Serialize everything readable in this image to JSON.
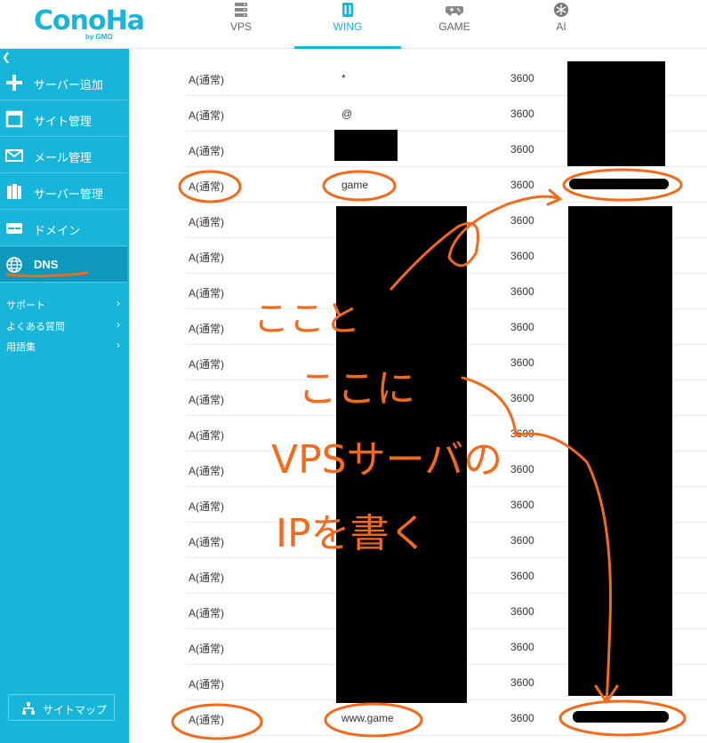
{
  "brand": {
    "logo": "ConoHa",
    "sub": "by GMO"
  },
  "nav": {
    "tabs": [
      {
        "label": "VPS",
        "icon": "server-icon"
      },
      {
        "label": "WING",
        "icon": "wing-icon"
      },
      {
        "label": "GAME",
        "icon": "gamepad-icon"
      },
      {
        "label": "AI",
        "icon": "ai-icon"
      }
    ],
    "active": "WING"
  },
  "sidebar": {
    "items": [
      {
        "label": "サーバー追加",
        "icon": "plus-icon"
      },
      {
        "label": "サイト管理",
        "icon": "window-icon"
      },
      {
        "label": "メール管理",
        "icon": "mail-icon"
      },
      {
        "label": "サーバー管理",
        "icon": "server-stack-icon"
      },
      {
        "label": "ドメイン",
        "icon": "domain-icon"
      },
      {
        "label": "DNS",
        "icon": "globe-icon"
      }
    ],
    "active": "DNS",
    "links": [
      {
        "label": "サポート"
      },
      {
        "label": "よくある質問"
      },
      {
        "label": "用語集"
      }
    ],
    "sitemap_label": "サイトマップ"
  },
  "records": [
    {
      "type": "A(通常)",
      "name": "*",
      "ttl": "3600"
    },
    {
      "type": "A(通常)",
      "name": "@",
      "ttl": "3600"
    },
    {
      "type": "A(通常)",
      "name": "",
      "ttl": "3600"
    },
    {
      "type": "A(通常)",
      "name": "game",
      "ttl": "3600"
    },
    {
      "type": "A(通常)",
      "name": "",
      "ttl": "3600"
    },
    {
      "type": "A(通常)",
      "name": "",
      "ttl": "3600"
    },
    {
      "type": "A(通常)",
      "name": "",
      "ttl": "3600"
    },
    {
      "type": "A(通常)",
      "name": "",
      "ttl": "3600"
    },
    {
      "type": "A(通常)",
      "name": "",
      "ttl": "3600"
    },
    {
      "type": "A(通常)",
      "name": "",
      "ttl": "3600"
    },
    {
      "type": "A(通常)",
      "name": "",
      "ttl": "3600"
    },
    {
      "type": "A(通常)",
      "name": "",
      "ttl": "3600"
    },
    {
      "type": "A(通常)",
      "name": "",
      "ttl": "3600"
    },
    {
      "type": "A(通常)",
      "name": "",
      "ttl": "3600"
    },
    {
      "type": "A(通常)",
      "name": "",
      "ttl": "3600"
    },
    {
      "type": "A(通常)",
      "name": "",
      "ttl": "3600"
    },
    {
      "type": "A(通常)",
      "name": "",
      "ttl": "3600"
    },
    {
      "type": "A(通常)",
      "name": "",
      "ttl": "3600"
    },
    {
      "type": "A(通常)",
      "name": "www.game",
      "ttl": "3600"
    }
  ],
  "annotation": {
    "line1": "ここと",
    "line2": "ここに",
    "line3": "VPSサーバの",
    "line4": "IPを書く",
    "color": "#f26a1b"
  },
  "colors": {
    "accent": "#16b5d9",
    "sidebar_active": "#0e98bc",
    "annotation": "#f26a1b"
  }
}
